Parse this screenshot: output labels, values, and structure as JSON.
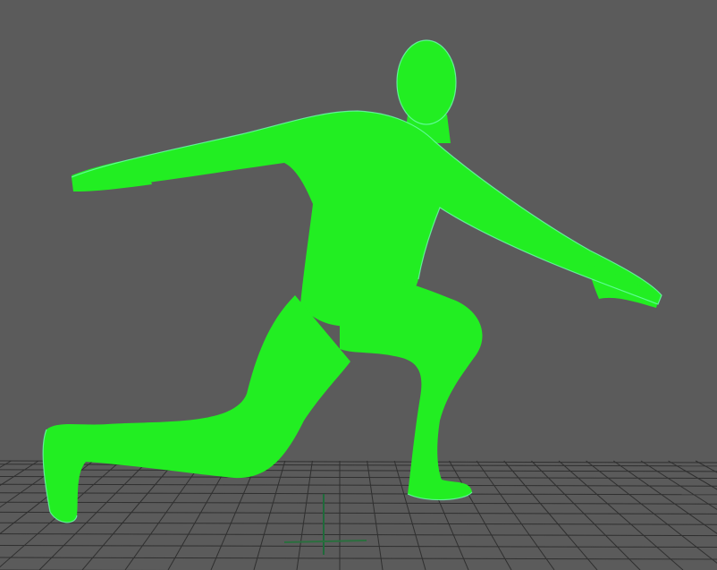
{
  "viewport": {
    "name": "3d-viewport",
    "background_color": "#5b5b5b",
    "grid_color": "#2f2f2f",
    "axis_x_color": "#1f6a3a",
    "axis_z_color": "#2a6f3e"
  },
  "model": {
    "name": "human-mesh-weight-paint",
    "base_color": "#22ee22",
    "wire_color": "#a6ffd6",
    "hot_colors": [
      "#ffff33",
      "#ff8a00",
      "#dd1e08"
    ]
  }
}
